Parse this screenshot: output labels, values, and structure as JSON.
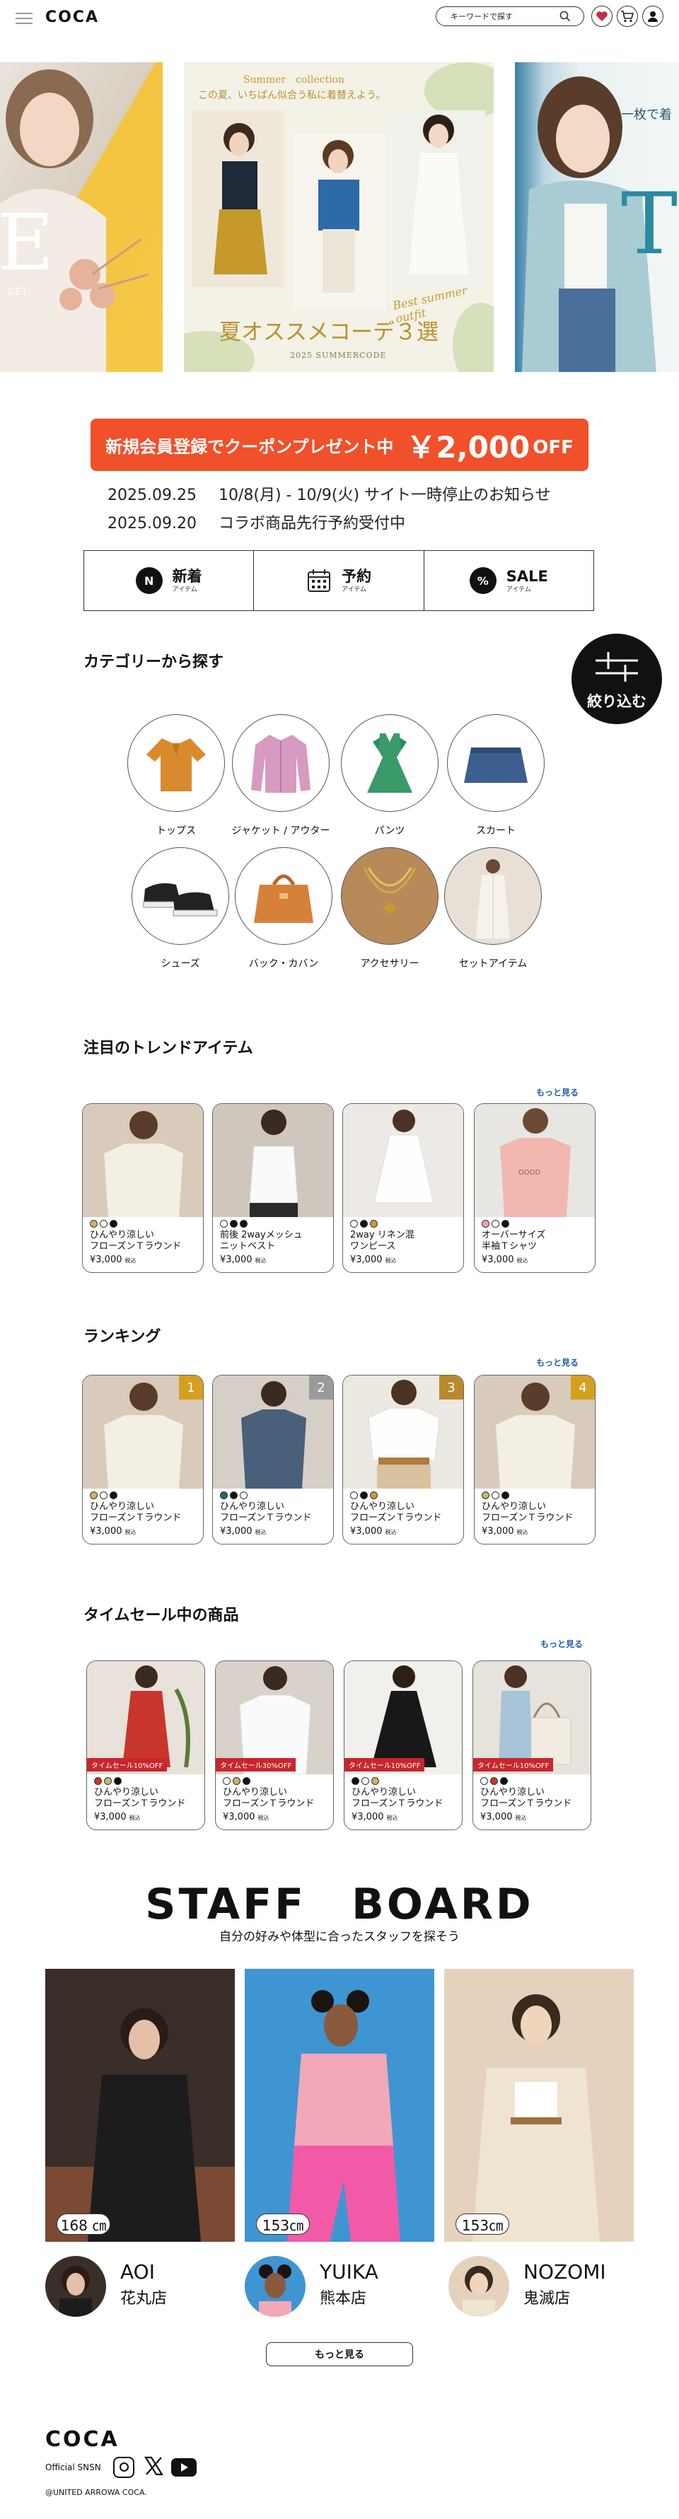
{
  "header": {
    "logo": "COCA",
    "search_placeholder": "キーワードで探す",
    "icons": [
      "menu-icon",
      "search-icon",
      "heart-icon",
      "cart-icon",
      "user-icon"
    ]
  },
  "banners": [
    {
      "big_letter": "E",
      "small_text": "GET"
    },
    {
      "top_label": "Summer　collection",
      "tagline": "この夏、いちばん似合う私に着替えよう。",
      "script": "Best summer outfit",
      "title": "夏オススメコーデ３選",
      "footer": "2025 SUMMERCODE"
    },
    {
      "small_text": "一枚で着",
      "big_letter": "T"
    }
  ],
  "coupon": {
    "text": "新規会員登録でクーポンプレゼント中",
    "amount": "￥2,000",
    "off": "OFF"
  },
  "news": [
    {
      "date": "2025.09.25",
      "text": "10/8(月) - 10/9(火) サイト一時停止のお知らせ"
    },
    {
      "date": "2025.09.20",
      "text": "コラボ商品先行予約受付中"
    }
  ],
  "quicknav": [
    {
      "badge": "N",
      "title": "新着",
      "sub": "アイテム"
    },
    {
      "badge": "",
      "title": "予約",
      "sub": "アイテム"
    },
    {
      "badge": "%",
      "title": "SALE",
      "sub": "アイテム"
    }
  ],
  "category": {
    "title": "カテゴリーから探す",
    "filter_label": "絞り込む",
    "items": [
      "トップス",
      "ジャケット / アウター",
      "パンツ",
      "スカート",
      "シューズ",
      "バック・カバン",
      "アクセサリー",
      "セットアイテム"
    ]
  },
  "trend": {
    "title": "注目のトレンドアイテム",
    "more": "もっと見る",
    "items": [
      {
        "name": "ひんやり涼しい\nフローズンＴラウンド",
        "price": "¥3,000",
        "tax": "税込"
      },
      {
        "name": "前後 2wayメッシュ\nニットベスト",
        "price": "¥3,000",
        "tax": "税込"
      },
      {
        "name": "2way リネン混\nワンピース",
        "price": "¥3,000",
        "tax": "税込"
      },
      {
        "name": "オーバーサイズ\n半袖Ｔシャツ",
        "price": "¥3,000",
        "tax": "税込"
      }
    ]
  },
  "ranking": {
    "title": "ランキング",
    "more": "もっと見る",
    "items": [
      {
        "rank": "1",
        "name": "ひんやり涼しい\nフローズンＴラウンド",
        "price": "¥3,000",
        "tax": "税込"
      },
      {
        "rank": "2",
        "name": "ひんやり涼しい\nフローズンＴラウンド",
        "price": "¥3,000",
        "tax": "税込"
      },
      {
        "rank": "3",
        "name": "ひんやり涼しい\nフローズンＴラウンド",
        "price": "¥3,000",
        "tax": "税込"
      },
      {
        "rank": "4",
        "name": "ひんやり涼しい\nフローズンＴラウンド",
        "price": "¥3,000",
        "tax": "税込"
      }
    ]
  },
  "timesale": {
    "title": "タイムセール中の商品",
    "more": "もっと見る",
    "items": [
      {
        "tag": "タイムセール10%OFF",
        "name": "ひんやり涼しい\nフローズンＴラウンド",
        "price": "¥3,000",
        "tax": "税込"
      },
      {
        "tag": "タイムセール30%OFF",
        "name": "ひんやり涼しい\nフローズンＴラウンド",
        "price": "¥3,000",
        "tax": "税込"
      },
      {
        "tag": "タイムセール10%OFF",
        "name": "ひんやり涼しい\nフローズンＴラウンド",
        "price": "¥3,000",
        "tax": "税込"
      },
      {
        "tag": "タイムセール10%OFF",
        "name": "ひんやり涼しい\nフローズンＴラウンド",
        "price": "¥3,000",
        "tax": "税込"
      }
    ]
  },
  "staff": {
    "title": "STAFF　BOARD",
    "subtitle": "自分の好みや体型に合ったスタッフを探そう",
    "more": "もっと見る",
    "members": [
      {
        "height": "168 ㎝",
        "name": "AOI",
        "shop": "花丸店"
      },
      {
        "height": "153㎝",
        "name": "YUIKA",
        "shop": "熊本店"
      },
      {
        "height": "153㎝",
        "name": "NOZOMI",
        "shop": "鬼滅店"
      }
    ]
  },
  "footer": {
    "logo": "COCA",
    "sns_label": "Official SNSN",
    "copyright": "@UNITED ARROWA COCA."
  },
  "colors": {
    "accent": "#f0502a",
    "link": "#1f5fa8",
    "sale_tag": "#c8262c",
    "rank_badge": "#b88a2e"
  }
}
